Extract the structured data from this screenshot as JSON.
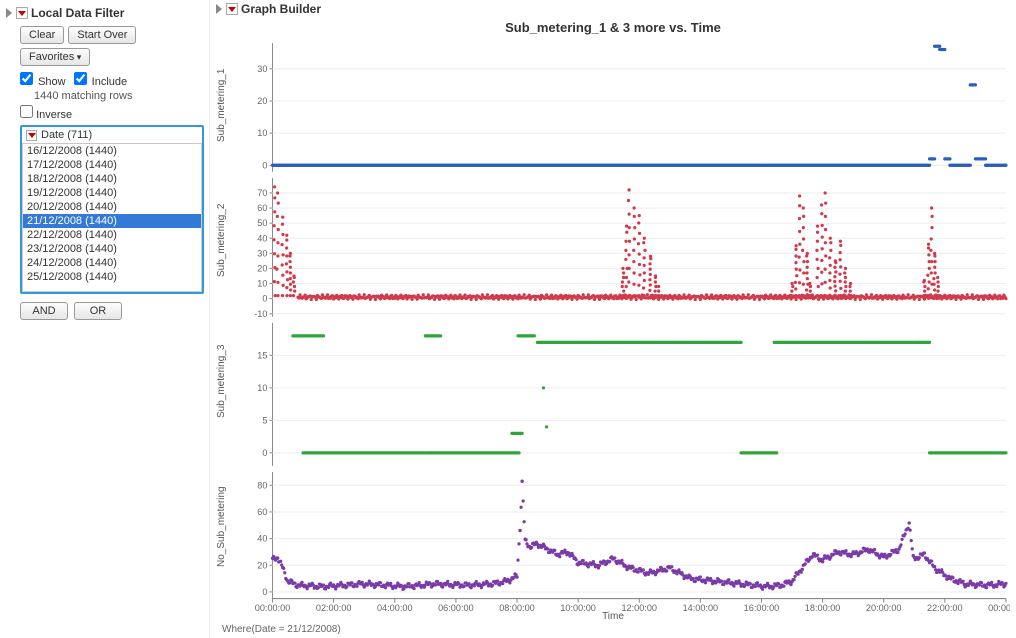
{
  "side": {
    "title": "Local Data Filter",
    "buttons": {
      "clear": "Clear",
      "start_over": "Start Over",
      "favorites": "Favorites"
    },
    "checks": {
      "show": "Show",
      "include": "Include",
      "inverse": "Inverse"
    },
    "matching": "1440 matching rows",
    "column_label": "Date (711)",
    "items": [
      "16/12/2008 (1440)",
      "17/12/2008 (1440)",
      "18/12/2008 (1440)",
      "19/12/2008 (1440)",
      "20/12/2008 (1440)",
      "21/12/2008 (1440)",
      "22/12/2008 (1440)",
      "23/12/2008 (1440)",
      "24/12/2008 (1440)",
      "25/12/2008 (1440)"
    ],
    "selected_index": 5,
    "and": "AND",
    "or": "OR"
  },
  "graph": {
    "title_panel": "Graph Builder",
    "chart_title": "Sub_metering_1 & 3 more vs. Time",
    "xlabel": "Time",
    "ylabels": [
      "Sub_metering_1",
      "Sub_metering_2",
      "Sub_metering_3",
      "No_Sub_metering"
    ],
    "x_ticks": [
      "00:00:00",
      "02:00:00",
      "04:00:00",
      "06:00:00",
      "08:00:00",
      "10:00:00",
      "12:00:00",
      "14:00:00",
      "16:00:00",
      "18:00:00",
      "20:00:00",
      "22:00:00",
      "00:00:00"
    ],
    "where": "Where(Date = 21/12/2008)"
  },
  "chart_data": [
    {
      "type": "scatter",
      "name": "Sub_metering_1",
      "color": "#2a5fb8",
      "ylim": [
        -2,
        38
      ],
      "yticks": [
        0,
        10,
        20,
        30
      ],
      "segments": [
        {
          "x0": 0,
          "x1": 1290,
          "y": 0
        },
        {
          "x0": 1290,
          "x1": 1300,
          "y": 2
        },
        {
          "x0": 1300,
          "x1": 1310,
          "y": 37
        },
        {
          "x0": 1310,
          "x1": 1320,
          "y": 36
        },
        {
          "x0": 1320,
          "x1": 1330,
          "y": 2
        },
        {
          "x0": 1330,
          "x1": 1370,
          "y": 0
        },
        {
          "x0": 1370,
          "x1": 1380,
          "y": 25
        },
        {
          "x0": 1380,
          "x1": 1400,
          "y": 2
        },
        {
          "x0": 1400,
          "x1": 1440,
          "y": 0
        }
      ]
    },
    {
      "type": "scatter",
      "name": "Sub_metering_2",
      "color": "#d13a4b",
      "ylim": [
        -12,
        80
      ],
      "yticks": [
        -10,
        0,
        10,
        20,
        30,
        40,
        50,
        60,
        70
      ],
      "spikes": [
        {
          "x": 4,
          "y": 74
        },
        {
          "x": 10,
          "y": 70
        },
        {
          "x": 20,
          "y": 54
        },
        {
          "x": 28,
          "y": 42
        },
        {
          "x": 35,
          "y": 30
        },
        {
          "x": 42,
          "y": 15
        },
        {
          "x": 688,
          "y": 20
        },
        {
          "x": 695,
          "y": 48
        },
        {
          "x": 700,
          "y": 72
        },
        {
          "x": 710,
          "y": 60
        },
        {
          "x": 720,
          "y": 55
        },
        {
          "x": 730,
          "y": 40
        },
        {
          "x": 742,
          "y": 28
        },
        {
          "x": 752,
          "y": 15
        },
        {
          "x": 758,
          "y": 8
        },
        {
          "x": 1020,
          "y": 10
        },
        {
          "x": 1028,
          "y": 35
        },
        {
          "x": 1035,
          "y": 68
        },
        {
          "x": 1042,
          "y": 60
        },
        {
          "x": 1050,
          "y": 30
        },
        {
          "x": 1055,
          "y": 10
        },
        {
          "x": 1070,
          "y": 48
        },
        {
          "x": 1078,
          "y": 62
        },
        {
          "x": 1085,
          "y": 70
        },
        {
          "x": 1095,
          "y": 40
        },
        {
          "x": 1105,
          "y": 25
        },
        {
          "x": 1115,
          "y": 38
        },
        {
          "x": 1125,
          "y": 20
        },
        {
          "x": 1135,
          "y": 10
        },
        {
          "x": 1280,
          "y": 12
        },
        {
          "x": 1288,
          "y": 36
        },
        {
          "x": 1294,
          "y": 60
        },
        {
          "x": 1300,
          "y": 30
        },
        {
          "x": 1306,
          "y": 14
        }
      ],
      "baseline": {
        "bands": [
          {
            "x0": 50,
            "x1": 1440,
            "y": 1,
            "jitter": 2
          }
        ]
      }
    },
    {
      "type": "scatter",
      "name": "Sub_metering_3",
      "color": "#2fa53a",
      "ylim": [
        -2,
        20
      ],
      "yticks": [
        0,
        5,
        10,
        15
      ],
      "segments": [
        {
          "x0": 40,
          "x1": 100,
          "y": 18
        },
        {
          "x0": 60,
          "x1": 310,
          "y": 0
        },
        {
          "x0": 310,
          "x1": 485,
          "y": 0
        },
        {
          "x0": 300,
          "x1": 330,
          "y": 18
        },
        {
          "x0": 470,
          "x1": 490,
          "y": 3
        },
        {
          "x0": 482,
          "x1": 515,
          "y": 18
        },
        {
          "x0": 520,
          "x1": 920,
          "y": 17
        },
        {
          "x0": 920,
          "x1": 990,
          "y": 0
        },
        {
          "x0": 985,
          "x1": 1270,
          "y": 17
        },
        {
          "x0": 1270,
          "x1": 1290,
          "y": 17
        },
        {
          "x0": 1290,
          "x1": 1440,
          "y": 0
        }
      ],
      "points": [
        {
          "x": 532,
          "y": 10
        },
        {
          "x": 538,
          "y": 4
        }
      ]
    },
    {
      "type": "scatter",
      "name": "No_Sub_metering",
      "color": "#7a3aa8",
      "ylim": [
        -5,
        90
      ],
      "yticks": [
        0,
        20,
        40,
        60,
        80
      ],
      "profile": [
        {
          "x": 0,
          "y": 24
        },
        {
          "x": 10,
          "y": 26
        },
        {
          "x": 20,
          "y": 18
        },
        {
          "x": 30,
          "y": 8
        },
        {
          "x": 50,
          "y": 5
        },
        {
          "x": 100,
          "y": 4
        },
        {
          "x": 180,
          "y": 6
        },
        {
          "x": 260,
          "y": 4
        },
        {
          "x": 320,
          "y": 6
        },
        {
          "x": 380,
          "y": 5
        },
        {
          "x": 430,
          "y": 6
        },
        {
          "x": 460,
          "y": 8
        },
        {
          "x": 480,
          "y": 12
        },
        {
          "x": 486,
          "y": 48
        },
        {
          "x": 490,
          "y": 82
        },
        {
          "x": 496,
          "y": 38
        },
        {
          "x": 505,
          "y": 34
        },
        {
          "x": 520,
          "y": 36
        },
        {
          "x": 540,
          "y": 32
        },
        {
          "x": 560,
          "y": 28
        },
        {
          "x": 580,
          "y": 30
        },
        {
          "x": 600,
          "y": 22
        },
        {
          "x": 640,
          "y": 20
        },
        {
          "x": 670,
          "y": 25
        },
        {
          "x": 700,
          "y": 18
        },
        {
          "x": 740,
          "y": 14
        },
        {
          "x": 780,
          "y": 18
        },
        {
          "x": 820,
          "y": 10
        },
        {
          "x": 870,
          "y": 8
        },
        {
          "x": 920,
          "y": 6
        },
        {
          "x": 970,
          "y": 4
        },
        {
          "x": 1000,
          "y": 5
        },
        {
          "x": 1020,
          "y": 8
        },
        {
          "x": 1040,
          "y": 18
        },
        {
          "x": 1060,
          "y": 28
        },
        {
          "x": 1080,
          "y": 24
        },
        {
          "x": 1110,
          "y": 30
        },
        {
          "x": 1140,
          "y": 28
        },
        {
          "x": 1170,
          "y": 32
        },
        {
          "x": 1200,
          "y": 26
        },
        {
          "x": 1230,
          "y": 32
        },
        {
          "x": 1250,
          "y": 52
        },
        {
          "x": 1258,
          "y": 25
        },
        {
          "x": 1280,
          "y": 28
        },
        {
          "x": 1300,
          "y": 18
        },
        {
          "x": 1330,
          "y": 10
        },
        {
          "x": 1360,
          "y": 6
        },
        {
          "x": 1400,
          "y": 5
        },
        {
          "x": 1440,
          "y": 6
        }
      ]
    }
  ]
}
